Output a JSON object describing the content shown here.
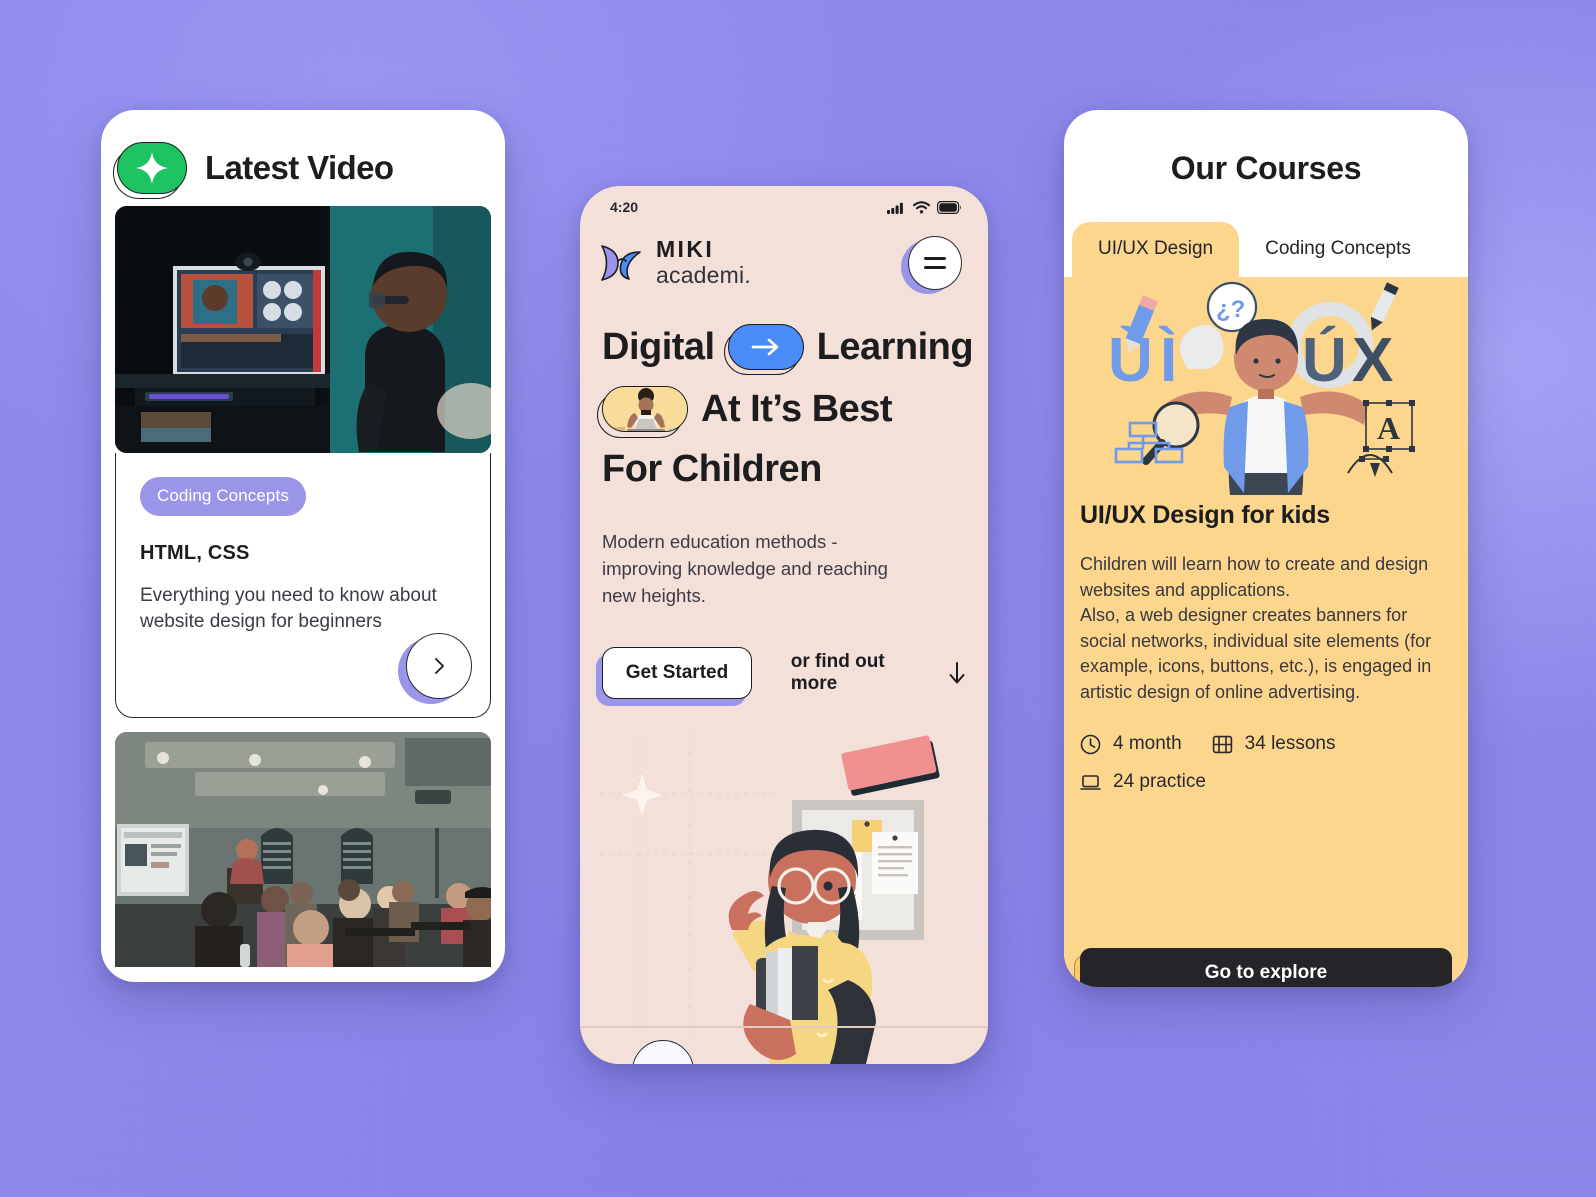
{
  "theme": {
    "background": "#8c88ea",
    "accent_purple": "#9b95ea",
    "accent_green": "#1fc261",
    "accent_blue": "#4a8cf7",
    "accent_yellow": "#fcd68c",
    "phone2_bg": "#f3e0d9",
    "ink": "#1d1d20"
  },
  "phone1": {
    "header": {
      "title": "Latest Video",
      "badge_icon": "sparkle-star-icon"
    },
    "video_thumbnail_alt": "student at desk with monitor on video call",
    "card": {
      "tag": "Coding Concepts",
      "title": "HTML, CSS",
      "description": "Everything you need to know about website design for beginners",
      "next_icon": "chevron-right-icon"
    },
    "second_thumbnail_alt": "classroom lecture with audience and projector screen"
  },
  "phone2": {
    "status_bar": {
      "time": "4:20",
      "icons": [
        "cellular-signal-icon",
        "wifi-icon",
        "battery-icon"
      ]
    },
    "brand": {
      "logo_icon": "butterfly-logo-icon",
      "line1": "MIKI",
      "line2": "academi."
    },
    "menu_icon": "hamburger-menu-icon",
    "headline": {
      "line1_word": "Digital",
      "line1_pill_icon": "arrow-right-icon",
      "line1_tail": "Learning",
      "line2_pill_icon": "person-at-laptop-photo",
      "line2_tail": "At It’s Best",
      "line3": "For Children"
    },
    "subtitle": "Modern education methods - improving knowledge and reaching new heights.",
    "primary_cta": "Get Started",
    "secondary_cta": "or find out more",
    "secondary_cta_icon": "arrow-down-icon",
    "illustration_alt": "girl with glasses holding books in front of noticeboard"
  },
  "phone3": {
    "title": "Our Courses",
    "tabs": [
      {
        "label": "UI/UX Design",
        "active": true
      },
      {
        "label": "Coding Concepts",
        "active": false
      }
    ],
    "illustration_alt": "man shrugging between UI and UX letters with design tool icons",
    "course": {
      "title": "UI/UX Design for kids",
      "description": "Children will learn how to create and design websites and applications.\nAlso, a web designer creates banners for social networks, individual site elements (for example, icons, buttons, etc.), is engaged in artistic design of online advertising.",
      "meta": [
        {
          "icon": "clock-icon",
          "label": "4 month"
        },
        {
          "icon": "film-strip-icon",
          "label": "34 lessons"
        },
        {
          "icon": "laptop-icon",
          "label": "24 practice"
        }
      ],
      "cta": "Go to explore"
    }
  }
}
